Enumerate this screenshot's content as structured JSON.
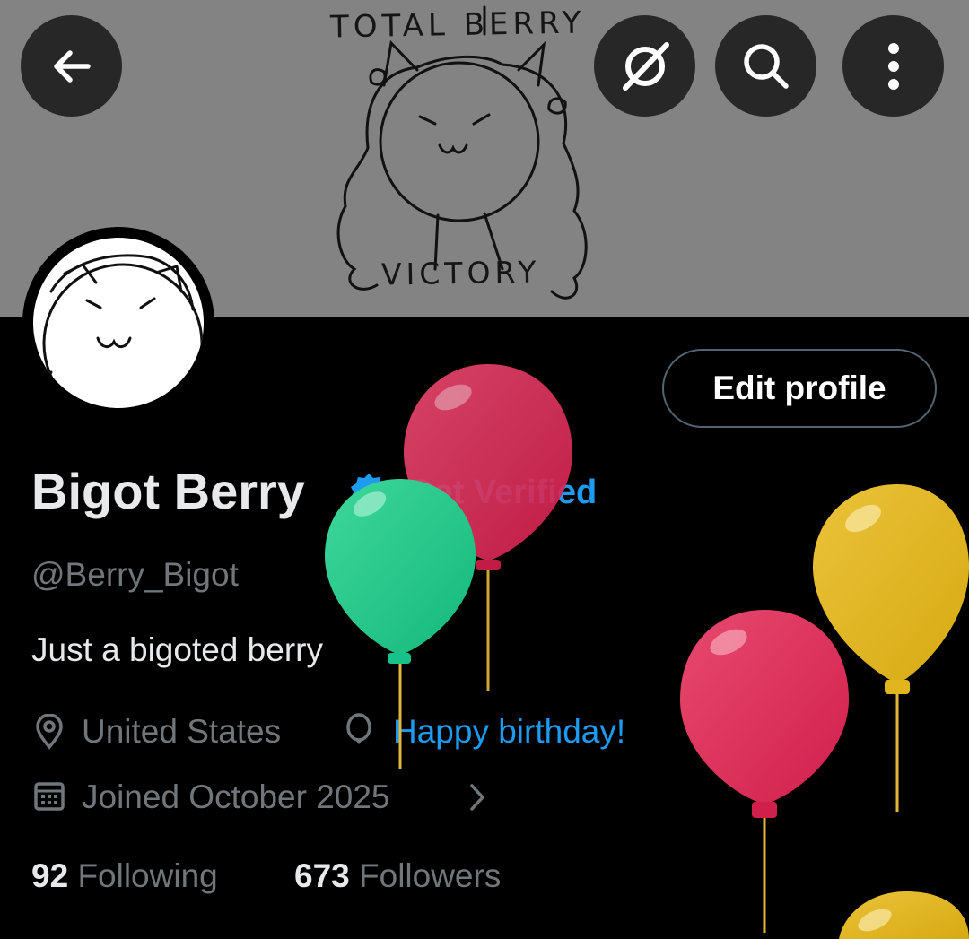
{
  "header": {
    "back_icon": "arrow-left-icon",
    "grok_icon": "grok-icon",
    "search_icon": "search-icon",
    "more_icon": "more-vertical-icon"
  },
  "banner": {
    "caption_top": "TOTAL BERRY",
    "caption_bottom": "VICTORY"
  },
  "profile": {
    "edit_label": "Edit profile",
    "name": "Bigot Berry",
    "get_verified": "Get Verified",
    "handle": "@Berry_Bigot",
    "bio": "Just a bigoted berry",
    "location": "United States",
    "birthday": "Happy birthday!",
    "joined": "Joined October 2025",
    "following_count": "92",
    "following_label": "Following",
    "followers_count": "673",
    "followers_label": "Followers"
  },
  "colors": {
    "accent": "#1d9bf0",
    "background": "#000000",
    "secondary_text": "#71767b"
  }
}
